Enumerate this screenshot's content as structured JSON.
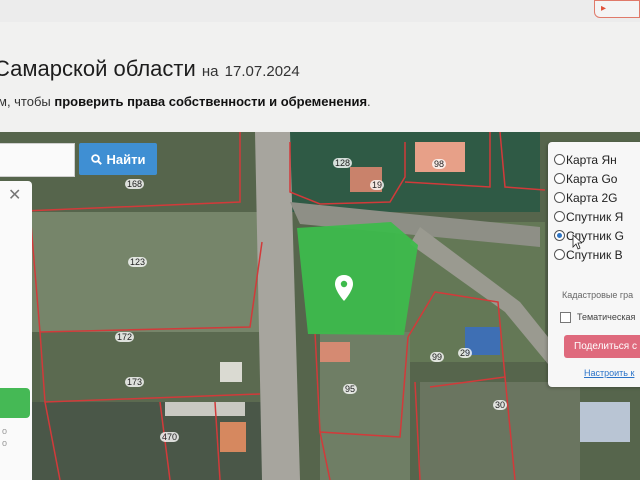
{
  "page": {
    "title": "Самарской области",
    "date_prefix": "на",
    "date": "17.07.2024",
    "subtitle_prefix": "м, чтобы",
    "subtitle_bold": "проверить права собственности и обременения",
    "subtitle_suffix": "."
  },
  "search": {
    "placeholder": "",
    "button_label": "Найти",
    "button_icon": "search-icon"
  },
  "map": {
    "plot_labels": [
      "168",
      "123",
      "172",
      "173",
      "470",
      "128",
      "19",
      "98",
      "99",
      "29",
      "95",
      "30"
    ],
    "selected_plot_color": "#3dbb4c",
    "boundary_color": "#d23a3a"
  },
  "layers": {
    "items": [
      {
        "label": "Карта Ян",
        "selected": false
      },
      {
        "label": "Карта Go",
        "selected": false
      },
      {
        "label": "Карта 2G",
        "selected": false
      },
      {
        "label": "Спутник Я",
        "selected": false
      },
      {
        "label": "Спутник G",
        "selected": true
      },
      {
        "label": "Спутник B",
        "selected": false
      }
    ],
    "cadastral_label": "Кадастровые гра",
    "thematic_label": "Тематическая",
    "share_label": "Поделиться с",
    "setup_link": "Настроить к"
  },
  "colors": {
    "search_button": "#3f8fd3",
    "share_button": "#df6a7d",
    "link": "#2a73c9"
  }
}
